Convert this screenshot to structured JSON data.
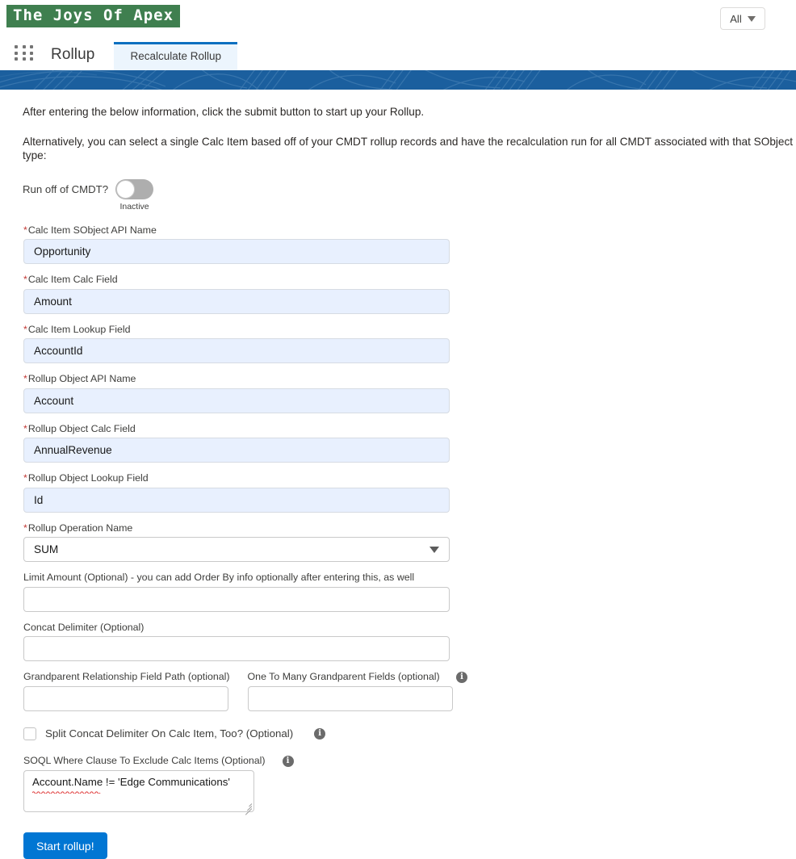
{
  "topbar": {
    "brand": "The Joys Of Apex",
    "scope_filter": {
      "label": "All",
      "icon": "chevron-down-icon"
    }
  },
  "nav": {
    "app_launcher_icon": "app-launcher-grid-icon",
    "app_name": "Rollup",
    "tabs": [
      {
        "label": "Recalculate Rollup",
        "active": true
      }
    ]
  },
  "content": {
    "intro_line_1": "After entering the below information, click the submit button to start up your Rollup.",
    "intro_line_2": "Alternatively, you can select a single Calc Item based off of your CMDT rollup records and have the recalculation run for all CMDT associated with that SObject type:",
    "cmdt_toggle": {
      "label": "Run off of CMDT?",
      "state_text": "Inactive",
      "checked": false
    },
    "fields": {
      "calc_item_sobject_api_name": {
        "label": "Calc Item SObject API Name",
        "required": true,
        "value": "Opportunity",
        "placeholder": ""
      },
      "calc_item_calc_field": {
        "label": "Calc Item Calc Field",
        "required": true,
        "value": "Amount",
        "placeholder": ""
      },
      "calc_item_lookup_field": {
        "label": "Calc Item Lookup Field",
        "required": true,
        "value": "AccountId",
        "placeholder": ""
      },
      "rollup_object_api_name": {
        "label": "Rollup Object API Name",
        "required": true,
        "value": "Account",
        "placeholder": ""
      },
      "rollup_object_calc_field": {
        "label": "Rollup Object Calc Field",
        "required": true,
        "value": "AnnualRevenue",
        "placeholder": ""
      },
      "rollup_object_lookup_field": {
        "label": "Rollup Object Lookup Field",
        "required": true,
        "value": "Id",
        "placeholder": ""
      },
      "rollup_operation_name": {
        "label": "Rollup Operation Name",
        "required": true,
        "value": "SUM",
        "icon": "chevron-down-icon"
      },
      "limit_amount": {
        "label": "Limit Amount (Optional) - you can add Order By info optionally after entering this, as well",
        "required": false,
        "value": "",
        "placeholder": ""
      },
      "concat_delimiter": {
        "label": "Concat Delimiter (Optional)",
        "required": false,
        "value": "",
        "placeholder": ""
      },
      "grandparent_relationship_field_path": {
        "label": "Grandparent Relationship Field Path (optional)",
        "required": false,
        "value": "",
        "placeholder": ""
      },
      "one_to_many_grandparent_fields": {
        "label": "One To Many Grandparent Fields (optional)",
        "required": false,
        "value": "",
        "placeholder": "",
        "info_icon": "info-icon"
      },
      "split_concat_delimiter": {
        "label": "Split Concat Delimiter On Calc Item, Too? (Optional)",
        "checked": false,
        "info_icon": "info-icon"
      },
      "soql_where_clause": {
        "label": "SOQL Where Clause To Exclude Calc Items (Optional)",
        "value": "Account.Name != 'Edge Communications'",
        "placeholder": "",
        "info_icon": "info-icon"
      }
    },
    "submit_button": "Start rollup!"
  },
  "colors": {
    "brand_green": "#3f7f4f",
    "banner_blue": "#1b5f9e",
    "tab_accent": "#0b6fc0",
    "tab_bg": "#ecf5fd",
    "primary_button": "#0176d3",
    "required_asterisk": "#c23934",
    "filled_input_bg": "#e8f0fe"
  }
}
